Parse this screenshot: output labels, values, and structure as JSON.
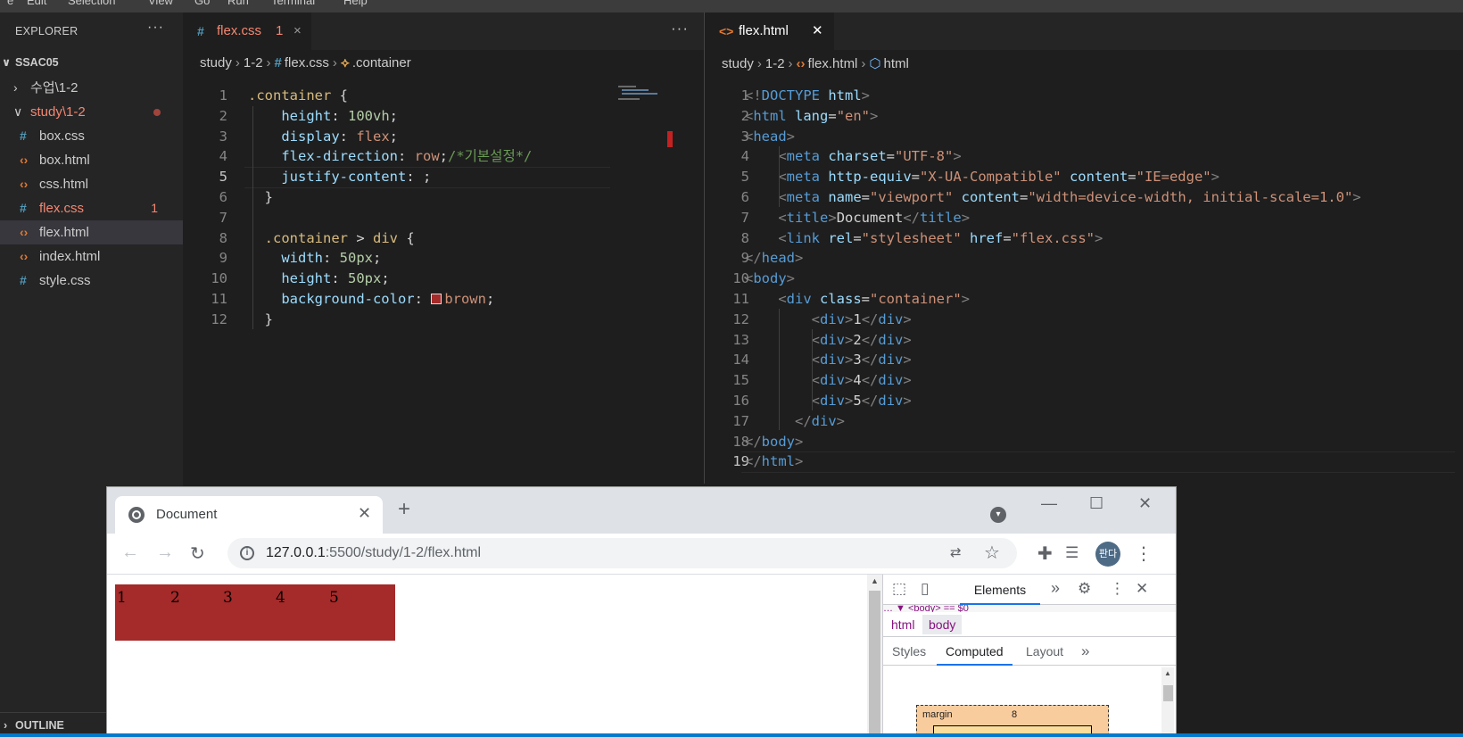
{
  "menubar": {
    "items": [
      "e",
      "Edit",
      "Selection",
      "View",
      "Go",
      "Run",
      "Terminal",
      "Help"
    ]
  },
  "explorer": {
    "title": "EXPLORER",
    "root": "SSAC05",
    "items": [
      {
        "label": "수업\\1-2",
        "kind": "folder"
      },
      {
        "label": "study\\1-2",
        "kind": "folder"
      },
      {
        "label": "box.css",
        "kind": "css"
      },
      {
        "label": "box.html",
        "kind": "html"
      },
      {
        "label": "css.html",
        "kind": "html"
      },
      {
        "label": "flex.css",
        "kind": "css",
        "badge": "1"
      },
      {
        "label": "flex.html",
        "kind": "html"
      },
      {
        "label": "index.html",
        "kind": "html"
      },
      {
        "label": "style.css",
        "kind": "css"
      }
    ],
    "outline": "OUTLINE",
    "colors": {
      "modified": "#f48771",
      "selected_bg": "#37373d"
    }
  },
  "editor_left": {
    "tab": {
      "icon": "#",
      "name": "flex.css",
      "badge": "1"
    },
    "breadcrumb": {
      "parts": [
        "study",
        "1-2",
        "flex.css",
        ".container"
      ]
    },
    "lines": [
      {
        "n": "1",
        "parts": [
          {
            "t": ".container ",
            "c": "k-sel"
          },
          {
            "t": "{",
            "c": "k-p"
          }
        ]
      },
      {
        "n": "2",
        "parts": [
          {
            "t": "    height",
            "c": "k-prop"
          },
          {
            "t": ": ",
            "c": "k-p"
          },
          {
            "t": "100vh",
            "c": "k-num"
          },
          {
            "t": ";",
            "c": "k-p"
          }
        ]
      },
      {
        "n": "3",
        "parts": [
          {
            "t": "    display",
            "c": "k-prop"
          },
          {
            "t": ": ",
            "c": "k-p"
          },
          {
            "t": "flex",
            "c": "k-val"
          },
          {
            "t": ";",
            "c": "k-p"
          }
        ]
      },
      {
        "n": "4",
        "parts": [
          {
            "t": "    flex-direction",
            "c": "k-prop"
          },
          {
            "t": ": ",
            "c": "k-p"
          },
          {
            "t": "row",
            "c": "k-val"
          },
          {
            "t": ";",
            "c": "k-p"
          },
          {
            "t": "/*기본설정*/",
            "c": "k-com"
          }
        ]
      },
      {
        "n": "5",
        "parts": [
          {
            "t": "    justify-content",
            "c": "k-prop"
          },
          {
            "t": ": ;",
            "c": "k-p"
          }
        ]
      },
      {
        "n": "6",
        "parts": [
          {
            "t": "  }",
            "c": "k-p"
          }
        ]
      },
      {
        "n": "7",
        "parts": []
      },
      {
        "n": "8",
        "parts": [
          {
            "t": "  .container ",
            "c": "k-sel"
          },
          {
            "t": "> ",
            "c": "k-p"
          },
          {
            "t": "div",
            "c": "k-sel"
          },
          {
            "t": " {",
            "c": "k-p"
          }
        ]
      },
      {
        "n": "9",
        "parts": [
          {
            "t": "    width",
            "c": "k-prop"
          },
          {
            "t": ": ",
            "c": "k-p"
          },
          {
            "t": "50px",
            "c": "k-num"
          },
          {
            "t": ";",
            "c": "k-p"
          }
        ]
      },
      {
        "n": "10",
        "parts": [
          {
            "t": "    height",
            "c": "k-prop"
          },
          {
            "t": ": ",
            "c": "k-p"
          },
          {
            "t": "50px",
            "c": "k-num"
          },
          {
            "t": ";",
            "c": "k-p"
          }
        ]
      },
      {
        "n": "11",
        "parts": [
          {
            "t": "    background-color",
            "c": "k-prop"
          },
          {
            "t": ": ",
            "c": "k-p"
          },
          {
            "t": "■",
            "c": "swatch"
          },
          {
            "t": "brown",
            "c": "k-val"
          },
          {
            "t": ";",
            "c": "k-p"
          }
        ]
      },
      {
        "n": "12",
        "parts": [
          {
            "t": "  }",
            "c": "k-p"
          }
        ]
      }
    ],
    "active_line": "5"
  },
  "editor_right": {
    "tab": {
      "icon": "<>",
      "name": "flex.html",
      "close": "✕"
    },
    "breadcrumb": {
      "parts": [
        "study",
        "1-2",
        "flex.html",
        "html"
      ]
    },
    "lines": [
      {
        "n": "1",
        "parts": [
          {
            "t": "<!",
            "c": "k-br"
          },
          {
            "t": "DOCTYPE",
            "c": "k-tag"
          },
          {
            "t": " html",
            "c": "k-at"
          },
          {
            "t": ">",
            "c": "k-br"
          }
        ]
      },
      {
        "n": "2",
        "parts": [
          {
            "t": "<",
            "c": "k-br"
          },
          {
            "t": "html",
            "c": "k-tag"
          },
          {
            "t": " lang",
            "c": "k-at"
          },
          {
            "t": "=",
            "c": "k-p"
          },
          {
            "t": "\"en\"",
            "c": "k-str"
          },
          {
            "t": ">",
            "c": "k-br"
          }
        ]
      },
      {
        "n": "3",
        "parts": [
          {
            "t": "<",
            "c": "k-br"
          },
          {
            "t": "head",
            "c": "k-tag"
          },
          {
            "t": ">",
            "c": "k-br"
          }
        ]
      },
      {
        "n": "4",
        "parts": [
          {
            "t": "    <",
            "c": "k-br"
          },
          {
            "t": "meta",
            "c": "k-tag"
          },
          {
            "t": " charset",
            "c": "k-at"
          },
          {
            "t": "=",
            "c": "k-p"
          },
          {
            "t": "\"UTF-8\"",
            "c": "k-str"
          },
          {
            "t": ">",
            "c": "k-br"
          }
        ]
      },
      {
        "n": "5",
        "parts": [
          {
            "t": "    <",
            "c": "k-br"
          },
          {
            "t": "meta",
            "c": "k-tag"
          },
          {
            "t": " http-equiv",
            "c": "k-at"
          },
          {
            "t": "=",
            "c": "k-p"
          },
          {
            "t": "\"X-UA-Compatible\"",
            "c": "k-str"
          },
          {
            "t": " content",
            "c": "k-at"
          },
          {
            "t": "=",
            "c": "k-p"
          },
          {
            "t": "\"IE=edge\"",
            "c": "k-str"
          },
          {
            "t": ">",
            "c": "k-br"
          }
        ]
      },
      {
        "n": "6",
        "parts": [
          {
            "t": "    <",
            "c": "k-br"
          },
          {
            "t": "meta",
            "c": "k-tag"
          },
          {
            "t": " name",
            "c": "k-at"
          },
          {
            "t": "=",
            "c": "k-p"
          },
          {
            "t": "\"viewport\"",
            "c": "k-str"
          },
          {
            "t": " content",
            "c": "k-at"
          },
          {
            "t": "=",
            "c": "k-p"
          },
          {
            "t": "\"width=device-width, initial-scale=1.0\"",
            "c": "k-str"
          },
          {
            "t": ">",
            "c": "k-br"
          }
        ]
      },
      {
        "n": "7",
        "parts": [
          {
            "t": "    <",
            "c": "k-br"
          },
          {
            "t": "title",
            "c": "k-tag"
          },
          {
            "t": ">",
            "c": "k-br"
          },
          {
            "t": "Document",
            "c": "k-p"
          },
          {
            "t": "</",
            "c": "k-br"
          },
          {
            "t": "title",
            "c": "k-tag"
          },
          {
            "t": ">",
            "c": "k-br"
          }
        ]
      },
      {
        "n": "8",
        "parts": [
          {
            "t": "    <",
            "c": "k-br"
          },
          {
            "t": "link",
            "c": "k-tag"
          },
          {
            "t": " rel",
            "c": "k-at"
          },
          {
            "t": "=",
            "c": "k-p"
          },
          {
            "t": "\"stylesheet\"",
            "c": "k-str"
          },
          {
            "t": " href",
            "c": "k-at"
          },
          {
            "t": "=",
            "c": "k-p"
          },
          {
            "t": "\"flex.css\"",
            "c": "k-str"
          },
          {
            "t": ">",
            "c": "k-br"
          }
        ]
      },
      {
        "n": "9",
        "parts": [
          {
            "t": "</",
            "c": "k-br"
          },
          {
            "t": "head",
            "c": "k-tag"
          },
          {
            "t": ">",
            "c": "k-br"
          }
        ]
      },
      {
        "n": "10",
        "parts": [
          {
            "t": "<",
            "c": "k-br"
          },
          {
            "t": "body",
            "c": "k-tag"
          },
          {
            "t": ">",
            "c": "k-br"
          }
        ]
      },
      {
        "n": "11",
        "parts": [
          {
            "t": "    <",
            "c": "k-br"
          },
          {
            "t": "div",
            "c": "k-tag"
          },
          {
            "t": " class",
            "c": "k-at"
          },
          {
            "t": "=",
            "c": "k-p"
          },
          {
            "t": "\"container\"",
            "c": "k-str"
          },
          {
            "t": ">",
            "c": "k-br"
          }
        ]
      },
      {
        "n": "12",
        "parts": [
          {
            "t": "        <",
            "c": "k-br"
          },
          {
            "t": "div",
            "c": "k-tag"
          },
          {
            "t": ">",
            "c": "k-br"
          },
          {
            "t": "1",
            "c": "k-p"
          },
          {
            "t": "</",
            "c": "k-br"
          },
          {
            "t": "div",
            "c": "k-tag"
          },
          {
            "t": ">",
            "c": "k-br"
          }
        ]
      },
      {
        "n": "13",
        "parts": [
          {
            "t": "        <",
            "c": "k-br"
          },
          {
            "t": "div",
            "c": "k-tag"
          },
          {
            "t": ">",
            "c": "k-br"
          },
          {
            "t": "2",
            "c": "k-p"
          },
          {
            "t": "</",
            "c": "k-br"
          },
          {
            "t": "div",
            "c": "k-tag"
          },
          {
            "t": ">",
            "c": "k-br"
          }
        ]
      },
      {
        "n": "14",
        "parts": [
          {
            "t": "        <",
            "c": "k-br"
          },
          {
            "t": "div",
            "c": "k-tag"
          },
          {
            "t": ">",
            "c": "k-br"
          },
          {
            "t": "3",
            "c": "k-p"
          },
          {
            "t": "</",
            "c": "k-br"
          },
          {
            "t": "div",
            "c": "k-tag"
          },
          {
            "t": ">",
            "c": "k-br"
          }
        ]
      },
      {
        "n": "15",
        "parts": [
          {
            "t": "        <",
            "c": "k-br"
          },
          {
            "t": "div",
            "c": "k-tag"
          },
          {
            "t": ">",
            "c": "k-br"
          },
          {
            "t": "4",
            "c": "k-p"
          },
          {
            "t": "</",
            "c": "k-br"
          },
          {
            "t": "div",
            "c": "k-tag"
          },
          {
            "t": ">",
            "c": "k-br"
          }
        ]
      },
      {
        "n": "16",
        "parts": [
          {
            "t": "        <",
            "c": "k-br"
          },
          {
            "t": "div",
            "c": "k-tag"
          },
          {
            "t": ">",
            "c": "k-br"
          },
          {
            "t": "5",
            "c": "k-p"
          },
          {
            "t": "</",
            "c": "k-br"
          },
          {
            "t": "div",
            "c": "k-tag"
          },
          {
            "t": ">",
            "c": "k-br"
          }
        ]
      },
      {
        "n": "17",
        "parts": [
          {
            "t": "      </",
            "c": "k-br"
          },
          {
            "t": "div",
            "c": "k-tag"
          },
          {
            "t": ">",
            "c": "k-br"
          }
        ]
      },
      {
        "n": "18",
        "parts": [
          {
            "t": "</",
            "c": "k-br"
          },
          {
            "t": "body",
            "c": "k-tag"
          },
          {
            "t": ">",
            "c": "k-br"
          }
        ]
      },
      {
        "n": "19",
        "parts": [
          {
            "t": "</",
            "c": "k-br"
          },
          {
            "t": "html",
            "c": "k-tag"
          },
          {
            "t": ">",
            "c": "k-br"
          }
        ]
      }
    ],
    "active_line": "19"
  },
  "browser": {
    "tab_title": "Document",
    "url_host": "127.0.0.1",
    "url_path": ":5500/study/1-2/flex.html",
    "avatar": "판다",
    "page_items": [
      "1",
      "2",
      "3",
      "4",
      "5"
    ],
    "page_bg": "#a52a2a"
  },
  "devtools": {
    "panel": "Elements",
    "dom_preview": "… ▼ <body> == $0",
    "crumbs": [
      "html",
      "body"
    ],
    "subtabs": [
      "Styles",
      "Computed",
      "Layout"
    ],
    "boxmodel": {
      "label": "margin",
      "value": "8"
    }
  }
}
